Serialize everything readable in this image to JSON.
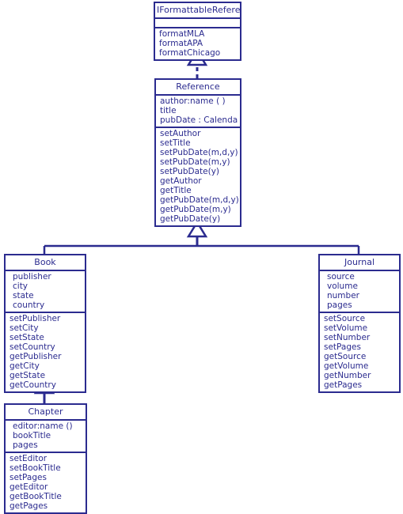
{
  "diagram": {
    "kind": "uml-class-diagram",
    "colors": {
      "stroke": "#2b2b8f",
      "text": "#2b2b8f",
      "background": "#ffffff"
    },
    "classes": {
      "iformattablereference": {
        "name": "IFormattableReference",
        "stereotype": "interface",
        "attributes": [],
        "methods": [
          "formatMLA",
          "formatAPA",
          "formatChicago"
        ]
      },
      "reference": {
        "name": "Reference",
        "attributes": [
          "author:name ( )",
          "title",
          "pubDate : Calendar"
        ],
        "methods": [
          "setAuthor",
          "setTitle",
          "setPubDate(m,d,y)",
          "setPubDate(m,y)",
          "setPubDate(y)",
          "getAuthor",
          "getTitle",
          "getPubDate(m,d,y)",
          "getPubDate(m,y)",
          "getPubDate(y)"
        ]
      },
      "book": {
        "name": "Book",
        "attributes": [
          "publisher",
          "city",
          "state",
          "country"
        ],
        "methods": [
          "setPublisher",
          "setCity",
          "setState",
          "setCountry",
          "getPublisher",
          "getCity",
          "getState",
          "getCountry"
        ]
      },
      "journal": {
        "name": "Journal",
        "attributes": [
          "source",
          "volume",
          "number",
          "pages"
        ],
        "methods": [
          "setSource",
          "setVolume",
          "setNumber",
          "setPages",
          "getSource",
          "getVolume",
          "getNumber",
          "getPages"
        ]
      },
      "chapter": {
        "name": "Chapter",
        "attributes": [
          "editor:name ()",
          "bookTitle",
          "pages"
        ],
        "methods": [
          "setEditor",
          "setBookTitle",
          "setPages",
          "getEditor",
          "getBookTitle",
          "getPages"
        ]
      }
    },
    "relationships": [
      {
        "name": "reference-realizes-iformattablereference",
        "type": "realization",
        "line": "dashed",
        "arrow": "hollow-triangle",
        "source": "Reference",
        "target": "IFormattableReference"
      },
      {
        "name": "book-extends-reference",
        "type": "generalization",
        "line": "solid",
        "arrow": "hollow-triangle",
        "source": "Book",
        "target": "Reference"
      },
      {
        "name": "journal-extends-reference",
        "type": "generalization",
        "line": "solid",
        "arrow": "hollow-triangle",
        "source": "Journal",
        "target": "Reference"
      },
      {
        "name": "chapter-extends-book",
        "type": "generalization",
        "line": "solid",
        "arrow": "hollow-triangle",
        "source": "Chapter",
        "target": "Book"
      }
    ]
  }
}
